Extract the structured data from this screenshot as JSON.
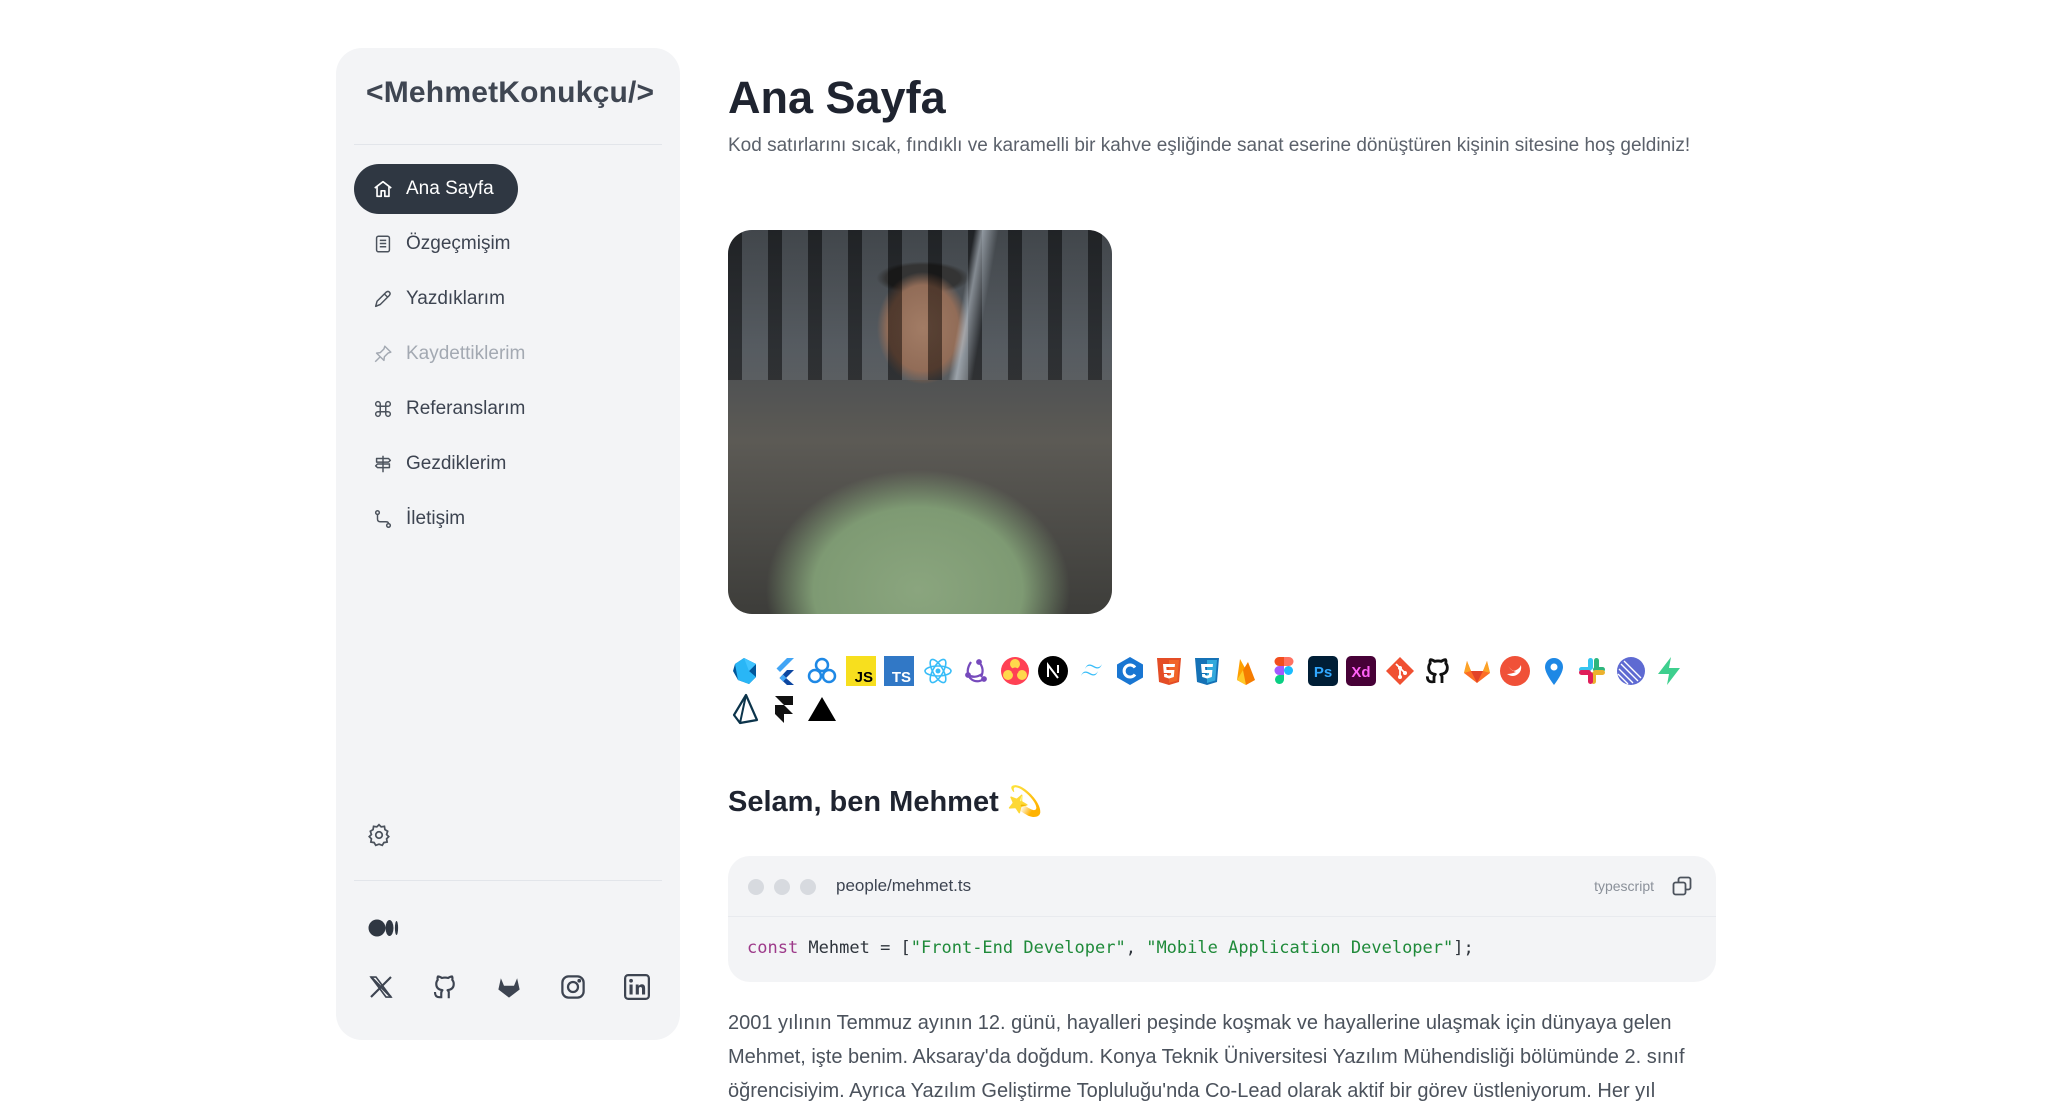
{
  "sidebar": {
    "brand": "<MehmetKonukçu/>",
    "nav": [
      {
        "label": "Ana Sayfa",
        "icon": "home-icon",
        "active": true
      },
      {
        "label": "Özgeçmişim",
        "icon": "document-icon"
      },
      {
        "label": "Yazdıklarım",
        "icon": "pen-icon"
      },
      {
        "label": "Kaydettiklerim",
        "icon": "pin-icon",
        "muted": true
      },
      {
        "label": "Referanslarım",
        "icon": "command-icon"
      },
      {
        "label": "Gezdiklerim",
        "icon": "signpost-icon"
      },
      {
        "label": "İletişim",
        "icon": "route-icon"
      }
    ],
    "settings_icon": "gear-icon",
    "medium_icon": "medium-icon",
    "socials": [
      "x-icon",
      "github-icon",
      "gitlab-icon",
      "instagram-icon",
      "linkedin-icon"
    ]
  },
  "main": {
    "title": "Ana Sayfa",
    "subtitle": "Kod satırlarını sıcak, fındıklı ve karamelli bir kahve eşliğinde sanat eserine dönüştüren kişinin sitesine hoş geldiniz!",
    "tech_icons": [
      "dart-icon",
      "flutter-icon",
      "riverpod-icon",
      "javascript-icon",
      "typescript-icon",
      "react-icon",
      "redux-icon",
      "react-query-icon",
      "nextjs-icon",
      "tailwind-icon",
      "c-icon",
      "html5-icon",
      "css3-icon",
      "firebase-icon",
      "figma-icon",
      "photoshop-icon",
      "adobe-xd-icon",
      "git-icon",
      "github-icon",
      "gitlab-icon",
      "swift-icon",
      "location-icon",
      "slack-icon",
      "linear-icon",
      "supabase-icon",
      "prisma-icon",
      "framer-icon",
      "vercel-icon"
    ],
    "section_title": "Selam, ben Mehmet 💫",
    "code": {
      "filename": "people/mehmet.ts",
      "language": "typescript",
      "keyword": "const",
      "identifier": " Mehmet = [",
      "string1": "\"Front-End Developer\"",
      "sep": ", ",
      "string2": "\"Mobile Application Developer\"",
      "end": "];"
    },
    "paragraph": "2001 yılının Temmuz ayının 12. günü, hayalleri peşinde koşmak ve hayallerine ulaşmak için dünyaya gelen Mehmet, işte benim. Aksaray'da doğdum. Konya Teknik Üniversitesi Yazılım Mühendisliği bölümünde 2. sınıf öğrencisiyim. Ayrıca Yazılım Geliştirme Topluluğu'nda Co-Lead olarak aktif bir görev üstleniyorum. Her yıl"
  }
}
